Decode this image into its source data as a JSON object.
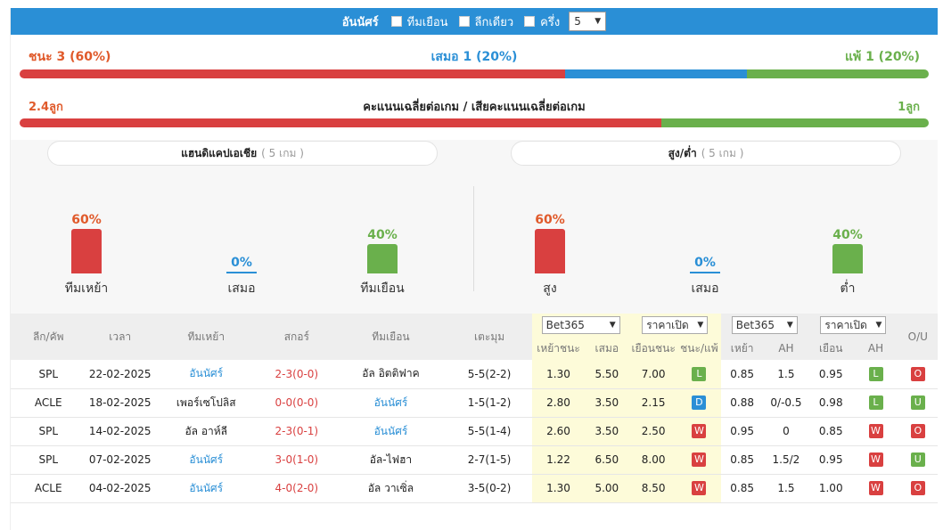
{
  "topbar": {
    "team": "อันนัศร์",
    "filters": [
      "ทีมเยือน",
      "ลีกเดียว",
      "ครึ่ง"
    ],
    "count_select": "5"
  },
  "summary": {
    "win_label": "ชนะ 3 (60%)",
    "draw_label": "เสมอ 1 (20%)",
    "loss_label": "แพ้ 1 (20%)",
    "win_pct": 60,
    "draw_pct": 20,
    "loss_pct": 20
  },
  "goals": {
    "scored_label": "2.4ลูก",
    "center_label": "คะแนนเฉลี่ยต่อเกม / เสียคะแนนเฉลี่ยต่อเกม",
    "conceded_label": "1ลูก",
    "scored": 2.4,
    "conceded": 1
  },
  "handicap": {
    "title": "แฮนดิแคปเอเชีย",
    "count": "( 5 เกม )",
    "items": [
      {
        "pct_label": "60%",
        "pct": 60,
        "label": "ทีมเหย้า",
        "color": "#d94040"
      },
      {
        "pct_label": "0%",
        "pct": 0,
        "label": "เสมอ",
        "color": "#2a8fd6"
      },
      {
        "pct_label": "40%",
        "pct": 40,
        "label": "ทีมเยือน",
        "color": "#6ab04c"
      }
    ]
  },
  "overunder": {
    "title": "สูง/ต่ำ",
    "count": "( 5 เกม )",
    "items": [
      {
        "pct_label": "60%",
        "pct": 60,
        "label": "สูง",
        "color": "#d94040"
      },
      {
        "pct_label": "0%",
        "pct": 0,
        "label": "เสมอ",
        "color": "#2a8fd6"
      },
      {
        "pct_label": "40%",
        "pct": 40,
        "label": "ต่ำ",
        "color": "#6ab04c"
      }
    ]
  },
  "table": {
    "headers": {
      "league": "ลีก/คัพ",
      "time": "เวลา",
      "home": "ทีมเหย้า",
      "score": "สกอร์",
      "away": "ทีมเยือน",
      "corners": "เตะมุม",
      "bookmaker1": "Bet365",
      "price1": "ราคาเปิด",
      "bookmaker2": "Bet365",
      "price2": "ราคาเปิด",
      "ou": "O/U",
      "home_win": "เหย้าชนะ",
      "draw": "เสมอ",
      "away_win": "เยือนชนะ",
      "wl": "ชนะ/แพ้",
      "h": "เหย้า",
      "ah": "AH",
      "a": "เยือน",
      "ah2": "AH"
    },
    "rows": [
      {
        "league": "SPL",
        "date": "22-02-2025",
        "home": "อันนัศร์",
        "home_hl": true,
        "score": "2-3(0-0)",
        "away": "อัล อิตติฟาค",
        "away_hl": false,
        "corners": "5-5(2-2)",
        "o1": "1.30",
        "o2": "5.50",
        "o3": "7.00",
        "r1": "L",
        "h": "0.85",
        "ah": "1.5",
        "a": "0.95",
        "r2": "L",
        "ou": "O"
      },
      {
        "league": "ACLE",
        "date": "18-02-2025",
        "home": "เพอร์เซโปลิส",
        "home_hl": false,
        "score": "0-0(0-0)",
        "away": "อันนัศร์",
        "away_hl": true,
        "corners": "1-5(1-2)",
        "o1": "2.80",
        "o2": "3.50",
        "o3": "2.15",
        "r1": "D",
        "h": "0.88",
        "ah": "0/-0.5",
        "a": "0.98",
        "r2": "L",
        "ou": "U"
      },
      {
        "league": "SPL",
        "date": "14-02-2025",
        "home": "อัล อาห์ลี",
        "home_hl": false,
        "score": "2-3(0-1)",
        "away": "อันนัศร์",
        "away_hl": true,
        "corners": "5-5(1-4)",
        "o1": "2.60",
        "o2": "3.50",
        "o3": "2.50",
        "r1": "W",
        "h": "0.95",
        "ah": "0",
        "a": "0.85",
        "r2": "W",
        "ou": "O"
      },
      {
        "league": "SPL",
        "date": "07-02-2025",
        "home": "อันนัศร์",
        "home_hl": true,
        "score": "3-0(1-0)",
        "away": "อัล-ไฟฮา",
        "away_hl": false,
        "corners": "2-7(1-5)",
        "o1": "1.22",
        "o2": "6.50",
        "o3": "8.00",
        "r1": "W",
        "h": "0.85",
        "ah": "1.5/2",
        "a": "0.95",
        "r2": "W",
        "ou": "U"
      },
      {
        "league": "ACLE",
        "date": "04-02-2025",
        "home": "อันนัศร์",
        "home_hl": true,
        "score": "4-0(2-0)",
        "away": "อัล วาเซิ่ล",
        "away_hl": false,
        "corners": "3-5(0-2)",
        "o1": "1.30",
        "o2": "5.00",
        "o3": "8.50",
        "r1": "W",
        "h": "0.85",
        "ah": "1.5",
        "a": "1.00",
        "r2": "W",
        "ou": "O"
      }
    ]
  }
}
